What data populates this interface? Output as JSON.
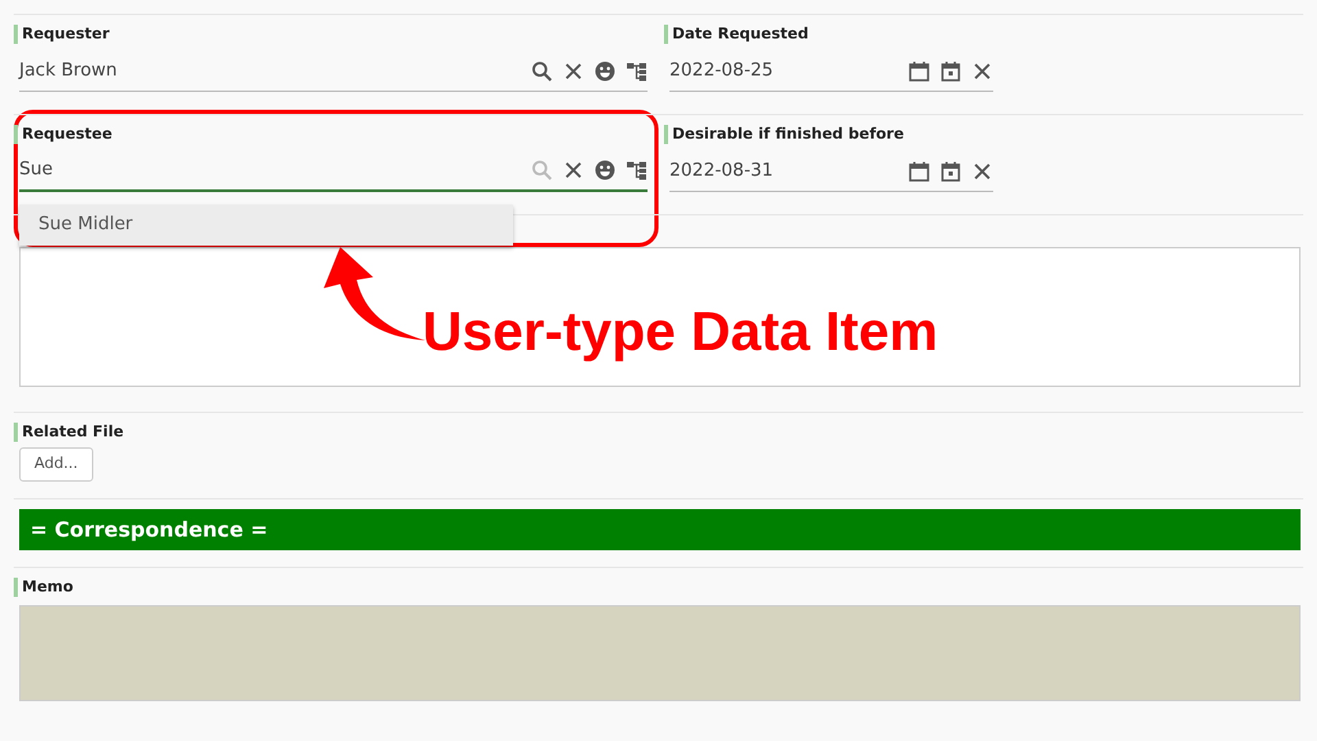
{
  "rows": [
    [
      {
        "kind": "user",
        "label": "Requester",
        "value": "Jack Brown",
        "focused": false
      },
      {
        "kind": "date",
        "label": "Date Requested",
        "value": "2022-08-25"
      }
    ],
    [
      {
        "kind": "user",
        "label": "Requestee",
        "value": "Sue",
        "focused": true,
        "suggestions": [
          "Sue Midler"
        ]
      },
      {
        "kind": "date",
        "label": "Desirable if finished before",
        "value": "2022-08-31"
      }
    ]
  ],
  "request_details": {
    "kind": "textarea"
  },
  "related_file": {
    "label": "Related File",
    "button": "Add..."
  },
  "section_title": "= Correspondence =",
  "memo": {
    "label": "Memo"
  },
  "annotation": {
    "text": "User-type Data Item"
  }
}
